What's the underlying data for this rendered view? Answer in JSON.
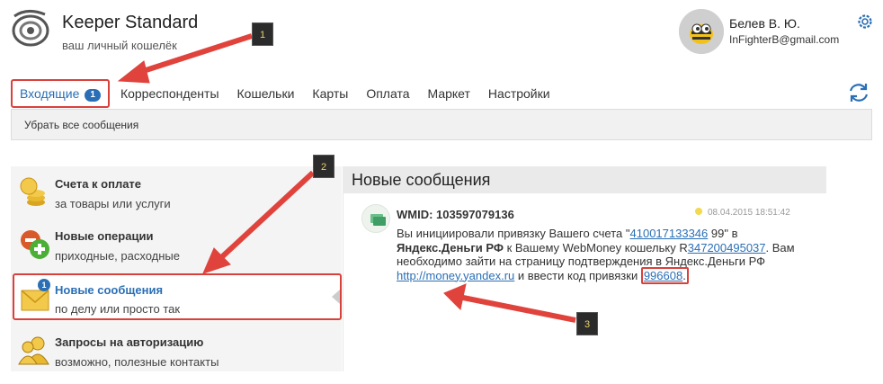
{
  "header": {
    "brand_title": "Keeper Standard",
    "brand_subtitle": "ваш личный кошелёк"
  },
  "user": {
    "name": "Белев В. Ю.",
    "email": "InFighterB@gmail.com"
  },
  "nav": {
    "items": [
      {
        "label": "Входящие",
        "badge": "1",
        "active": true
      },
      {
        "label": "Корреспонденты"
      },
      {
        "label": "Кошельки"
      },
      {
        "label": "Карты"
      },
      {
        "label": "Оплата"
      },
      {
        "label": "Маркет"
      },
      {
        "label": "Настройки"
      }
    ]
  },
  "subbar": {
    "action_label": "Убрать все сообщения"
  },
  "sidebar": {
    "items": [
      {
        "title": "Счета к оплате",
        "subtitle": "за товары или услуги",
        "icon": "coins-icon"
      },
      {
        "title": "Новые операции",
        "subtitle": "приходные, расходные",
        "icon": "plus-operation-icon"
      },
      {
        "title": "Новые сообщения",
        "subtitle": "по делу или просто так",
        "icon": "envelope-icon",
        "badge": "1",
        "active": true
      },
      {
        "title": "Запросы на авторизацию",
        "subtitle": "возможно, полезные контакты",
        "icon": "users-icon"
      }
    ]
  },
  "panel": {
    "title": "Новые сообщения"
  },
  "message": {
    "from": "WMID: 103597079136",
    "date": "08.04.2015 18:51:42",
    "text_1": "Вы инициировали привязку Вашего счета \"",
    "account": "410017133346",
    "text_2": " 99\" в ",
    "service": "Яндекс.Деньги РФ",
    "text_3": " к Вашему WebMoney кошельку R",
    "wallet": "347200495037",
    "text_4": ". Вам необходимо зайти на страницу подтверждения в Яндекс.Деньги РФ ",
    "link": "http://money.yandex.ru",
    "text_5": " и ввести код привязки ",
    "code": "996608"
  },
  "annotations": {
    "n1": "1",
    "n2": "2",
    "n3": "3"
  },
  "colors": {
    "accent": "#2a6fb6",
    "highlight": "#d9413b"
  }
}
